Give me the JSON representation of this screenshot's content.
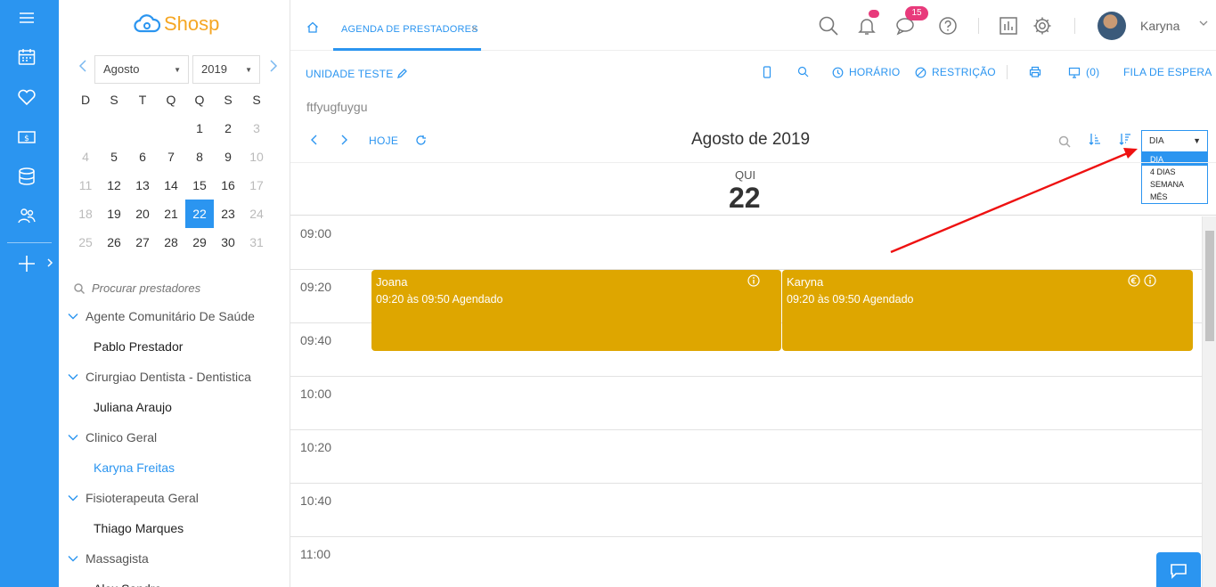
{
  "brand": {
    "name": "Shosp"
  },
  "rail": {
    "items": [
      {
        "icon": "menu-icon"
      },
      {
        "icon": "calendar-icon"
      },
      {
        "icon": "heart-icon"
      },
      {
        "icon": "money-icon"
      },
      {
        "icon": "database-icon"
      },
      {
        "icon": "users-icon"
      },
      {
        "icon": "plus-icon"
      }
    ]
  },
  "mini_calendar": {
    "month": "Agosto",
    "year": "2019",
    "weekdays": [
      "D",
      "S",
      "T",
      "Q",
      "Q",
      "S",
      "S"
    ],
    "weeks": [
      [
        "",
        "",
        "",
        "",
        "1",
        "2",
        "3"
      ],
      [
        "4",
        "5",
        "6",
        "7",
        "8",
        "9",
        "10"
      ],
      [
        "11",
        "12",
        "13",
        "14",
        "15",
        "16",
        "17"
      ],
      [
        "18",
        "19",
        "20",
        "21",
        "22",
        "23",
        "24"
      ],
      [
        "25",
        "26",
        "27",
        "28",
        "29",
        "30",
        "31"
      ]
    ],
    "selected_day": "22"
  },
  "providers": {
    "search_placeholder": "Procurar prestadores",
    "groups": [
      {
        "name": "Agente Comunitário De Saúde",
        "members": [
          "Pablo Prestador"
        ]
      },
      {
        "name": "Cirurgiao Dentista - Dentistica",
        "members": [
          "Juliana Araujo"
        ]
      },
      {
        "name": "Clinico Geral",
        "members": [
          "Karyna Freitas"
        ]
      },
      {
        "name": "Fisioterapeuta Geral",
        "members": [
          "Thiago Marques"
        ]
      },
      {
        "name": "Massagista",
        "members": [
          "Alex Sandro"
        ]
      }
    ],
    "active_member": "Karyna Freitas"
  },
  "topbar": {
    "tab_label": "AGENDA DE PRESTADORES",
    "tab_close": "×",
    "messages_count": "15",
    "user_name": "Karyna"
  },
  "toolbar": {
    "unit_label": "UNIDADE TESTE",
    "horario": "HORÁRIO",
    "restricao": "RESTRIÇÃO",
    "monitor_count": "(0)",
    "fila": "FILA DE ESPERA",
    "note": "ftfyugfuygu",
    "hoje": "HOJE",
    "title": "Agosto de 2019"
  },
  "view": {
    "selected": "DIA",
    "options": [
      "DIA",
      "4 DIAS",
      "SEMANA",
      "MÊS"
    ]
  },
  "day": {
    "weekday": "QUI",
    "number": "22"
  },
  "slots": [
    "09:00",
    "09:20",
    "09:40",
    "10:00",
    "10:20",
    "10:40",
    "11:00"
  ],
  "events": [
    {
      "name": "Joana",
      "time": "09:20 às 09:50 Agendado"
    },
    {
      "name": "Karyna",
      "time": "09:20 às 09:50 Agendado"
    }
  ],
  "colors": {
    "primary": "#2b95f0",
    "event": "#dea600",
    "badge": "#e83a7b",
    "logo_accent": "#f5a623"
  }
}
